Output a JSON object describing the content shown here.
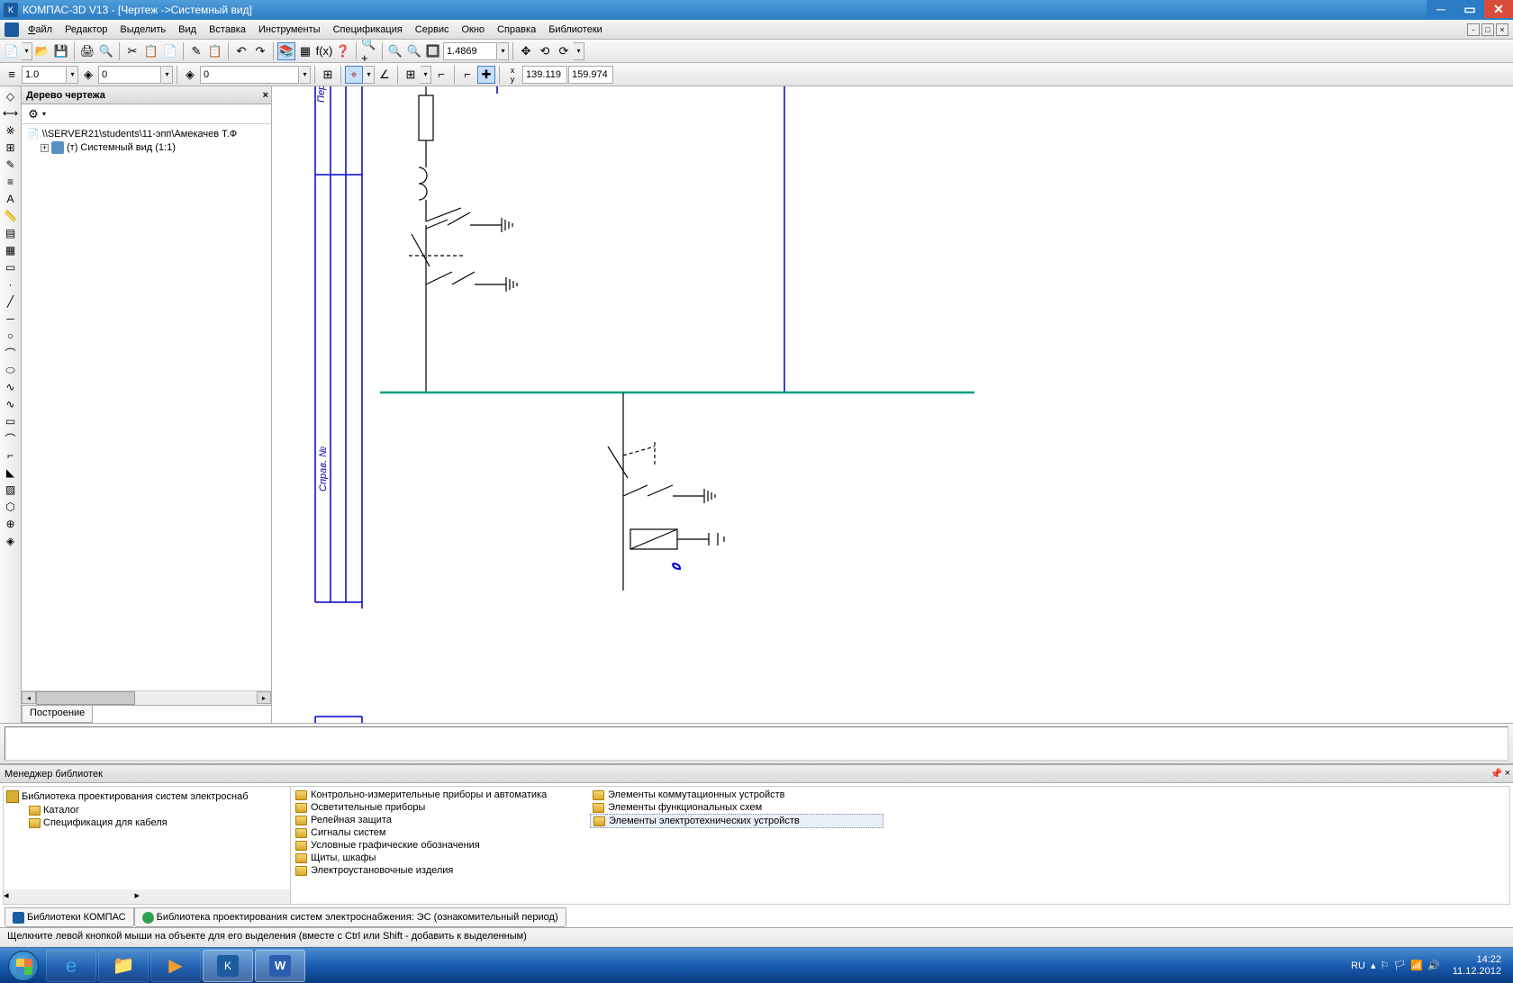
{
  "title": "КОМПАС-3D V13 - [Чертеж ->Системный вид]",
  "menu": {
    "file": "Файл",
    "edit": "Редактор",
    "select": "Выделить",
    "view": "Вид",
    "insert": "Вставка",
    "tools": "Инструменты",
    "spec": "Спецификация",
    "service": "Сервис",
    "window": "Окно",
    "help": "Справка",
    "libs": "Библиотеки"
  },
  "toolbar1": {
    "zoom": "1.4869"
  },
  "toolbar2": {
    "val1": "1.0",
    "val2": "0",
    "val3": "0",
    "coord_x": "139.119",
    "coord_y": "159.974"
  },
  "tree": {
    "title": "Дерево чертежа",
    "root": "\\\\SERVER21\\students\\11-эпп\\Амекачев Т.Ф",
    "child": "(т) Системный вид (1:1)",
    "tab": "Построение"
  },
  "canvas": {
    "label1": "Пер",
    "label2": "Справ. №"
  },
  "library": {
    "title": "Менеджер библиотек",
    "tree_root": "Библиотека проектирования систем электроснаб",
    "tree_c1": "Каталог",
    "tree_c2": "Спецификация для кабеля",
    "col1": [
      "Контрольно-измерительные приборы и автоматика",
      "Осветительные приборы",
      "Релейная защита",
      "Сигналы систем",
      "Условные графические обозначения",
      "Щиты, шкафы",
      "Электроустановочные изделия"
    ],
    "col2": [
      "Элементы коммутационных устройств",
      "Элементы функциональных схем",
      "Элементы электротехнических устройств"
    ],
    "tab1": "Библиотеки КОМПАС",
    "tab2": "Библиотека проектирования систем электроснабжения: ЭС (ознакомительный период)"
  },
  "status": "Щелкните левой кнопкой мыши на объекте для его выделения (вместе с Ctrl или Shift - добавить к выделенным)",
  "tray": {
    "lang": "RU",
    "time": "14:22",
    "date": "11.12.2012"
  }
}
